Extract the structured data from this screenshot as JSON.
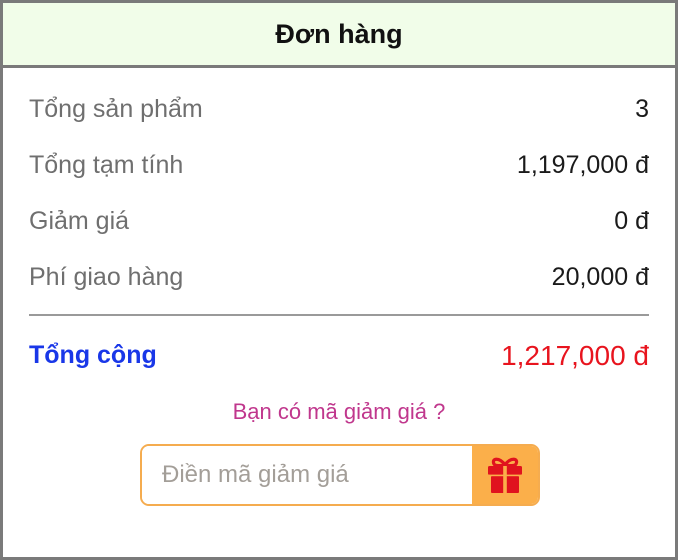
{
  "header": {
    "title": "Đơn hàng"
  },
  "summary": {
    "rows": [
      {
        "label": "Tổng sản phẩm",
        "value": "3"
      },
      {
        "label": "Tổng tạm tính",
        "value": "1,197,000 đ"
      },
      {
        "label": "Giảm giá",
        "value": "0 đ"
      },
      {
        "label": "Phí giao hàng",
        "value": "20,000 đ"
      }
    ],
    "total": {
      "label": "Tổng cộng",
      "value": "1,217,000 đ"
    }
  },
  "coupon": {
    "prompt": "Bạn có mã giảm giá ?",
    "placeholder": "Điền mã giảm giá",
    "value": "",
    "button_icon": "gift-icon"
  },
  "colors": {
    "header_bg": "#f1fde9",
    "total_label": "#1937e8",
    "total_value": "#e8141e",
    "prompt": "#c0378d",
    "accent": "#fbaf4a",
    "gift": "#e0131e"
  }
}
